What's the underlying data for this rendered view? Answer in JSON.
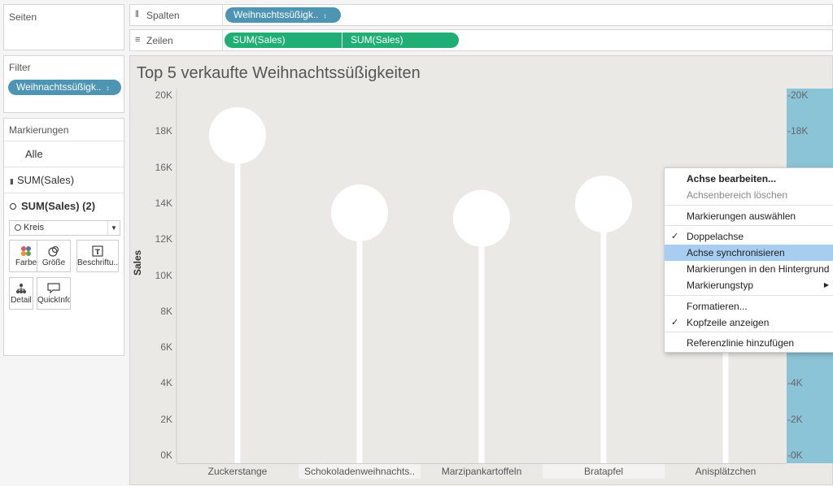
{
  "pages_panel": {
    "title": "Seiten"
  },
  "filter_panel": {
    "title": "Filter",
    "pill": "Weihnachtssüßigk.."
  },
  "marks_panel": {
    "title": "Markierungen",
    "rows": [
      "Alle",
      "SUM(Sales)",
      "SUM(Sales) (2)"
    ],
    "mark_type": "Kreis",
    "cards": [
      "Farbe",
      "Größe",
      "Beschriftu..",
      "Detail",
      "QuickInfo"
    ]
  },
  "columns_shelf": {
    "label": "Spalten",
    "pill": "Weihnachtssüßigk.."
  },
  "rows_shelf": {
    "label": "Zeilen",
    "pills": [
      "SUM(Sales)",
      "SUM(Sales)"
    ]
  },
  "colors": {
    "pill_blue": "#4d95b2",
    "pill_green": "#1fae74",
    "view_bg": "#ebe9e5",
    "axis_highlight": "#8bc4d6",
    "menu_highlight": "#a7cdf1"
  },
  "chart_data": {
    "type": "lollipop",
    "title": "Top 5 verkaufte Weihnachtssüßigkeiten",
    "ylabel": "Sales",
    "ylim": [
      0,
      20000
    ],
    "y_ticks": [
      "20K",
      "18K",
      "16K",
      "14K",
      "12K",
      "10K",
      "8K",
      "6K",
      "4K",
      "2K",
      "0K"
    ],
    "right_axis_ticks": [
      "20K",
      "18K",
      "6K",
      "4K",
      "2K",
      "0K"
    ],
    "categories": [
      "Zuckerstange",
      "Schokoladenweihnachts..",
      "Marzipankartoffeln",
      "Bratapfel",
      "Anisplätzchen"
    ],
    "values": [
      17800,
      13500,
      13200,
      14000,
      12000
    ]
  },
  "context_menu": {
    "items": [
      {
        "label": "Achse bearbeiten...",
        "style": "bold"
      },
      {
        "label": "Achsenbereich löschen",
        "style": "dim"
      },
      {
        "label": "Markierungen auswählen"
      },
      {
        "label": "Doppelachse",
        "checked": true
      },
      {
        "label": "Achse synchronisieren",
        "highlighted": true
      },
      {
        "label": "Markierungen in den Hintergrund"
      },
      {
        "label": "Markierungstyp",
        "submenu": true
      },
      {
        "label": "Formatieren..."
      },
      {
        "label": "Kopfzeile anzeigen",
        "checked": true
      },
      {
        "label": "Referenzlinie hinzufügen"
      }
    ]
  }
}
